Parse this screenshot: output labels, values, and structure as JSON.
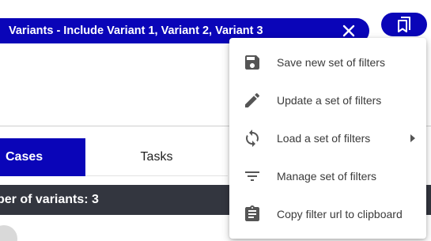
{
  "filter_chip": {
    "label": "Variants - Include Variant 1, Variant 2, Variant 3"
  },
  "tabs": [
    {
      "label": "Cases"
    },
    {
      "label": "Tasks"
    }
  ],
  "count_bar": {
    "label": "ber of variants: 3"
  },
  "filter_menu": {
    "items": [
      {
        "label": "Save new set of filters",
        "icon": "save-icon"
      },
      {
        "label": "Update a set of filters",
        "icon": "pencil-icon"
      },
      {
        "label": "Load a set of filters",
        "icon": "sync-icon",
        "has_submenu": true
      },
      {
        "label": "Manage set of filters",
        "icon": "filter-list-icon"
      },
      {
        "label": "Copy filter url to clipboard",
        "icon": "clipboard-icon"
      }
    ]
  },
  "colors": {
    "primary": "#0a05b8",
    "count_bar_bg": "#33363f",
    "menu_icon": "#555555"
  }
}
